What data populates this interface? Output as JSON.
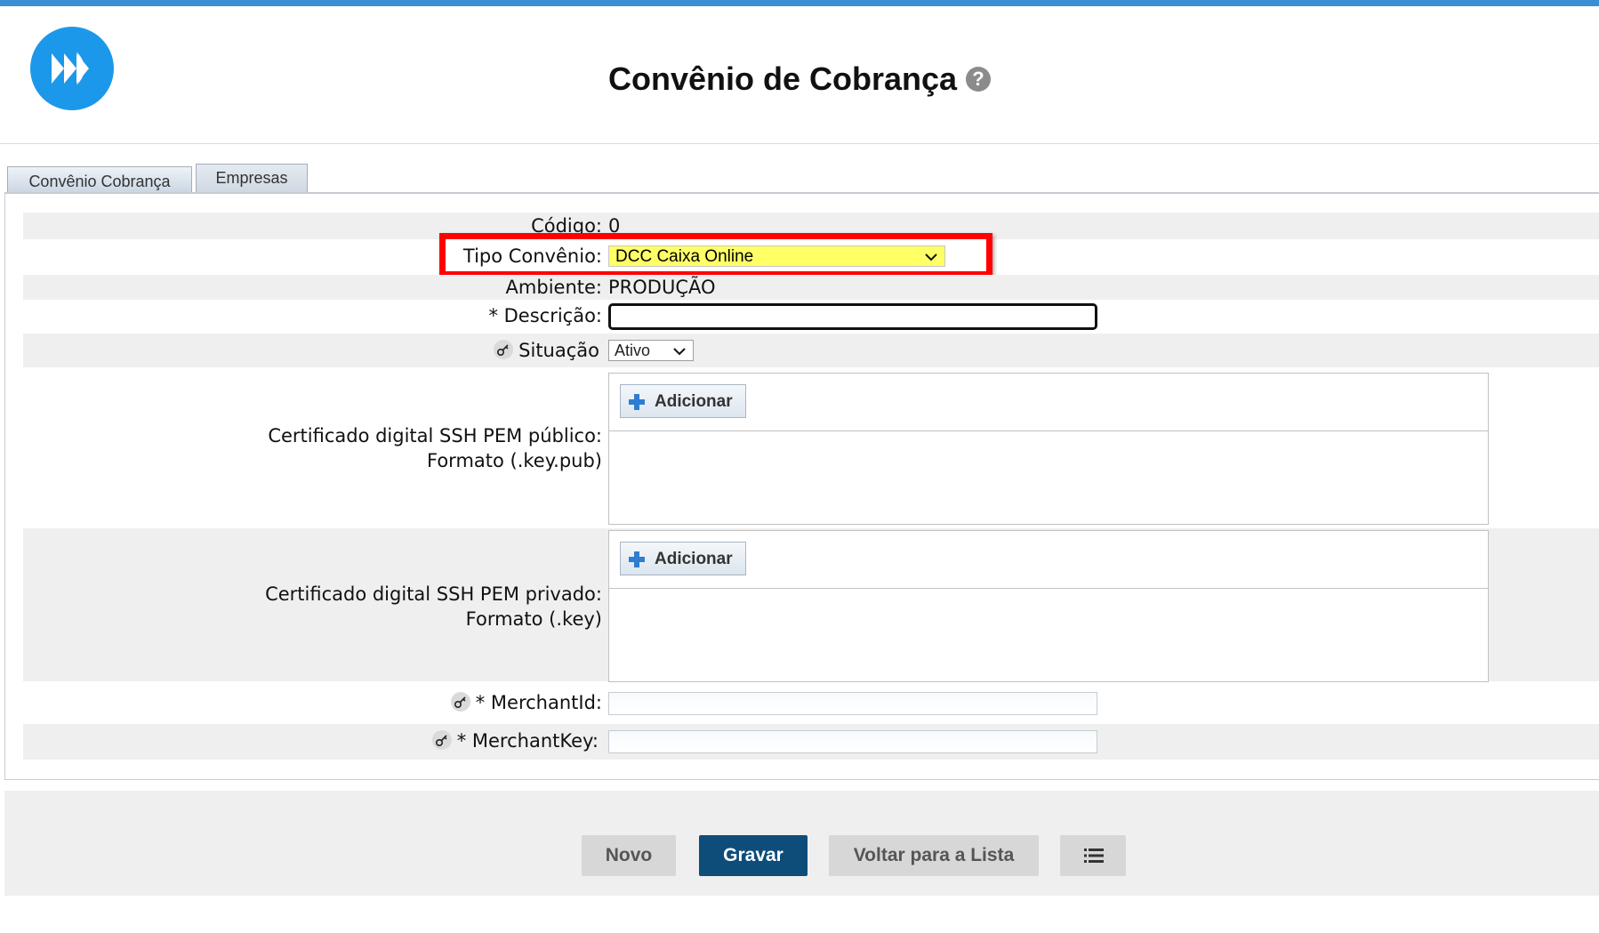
{
  "header": {
    "title": "Convênio de Cobrança",
    "help_icon": "?"
  },
  "tabs": [
    {
      "label": "Convênio Cobrança"
    },
    {
      "label": "Empresas"
    }
  ],
  "form": {
    "codigo": {
      "label": "Código:",
      "value": "0"
    },
    "tipo_convenio": {
      "label": "Tipo Convênio:",
      "selected": "DCC Caixa Online"
    },
    "ambiente": {
      "label": "Ambiente:",
      "value": "PRODUÇÃO"
    },
    "descricao": {
      "label": "* Descrição:",
      "value": ""
    },
    "situacao": {
      "label": "Situação",
      "selected": "Ativo"
    },
    "cert_publico": {
      "label_line1": "Certificado digital SSH PEM público:",
      "label_line2": "Formato (.key.pub)",
      "button": "Adicionar"
    },
    "cert_privado": {
      "label_line1": "Certificado digital SSH PEM privado:",
      "label_line2": "Formato (.key)",
      "button": "Adicionar"
    },
    "merchant_id": {
      "label": "* MerchantId:",
      "value": ""
    },
    "merchant_key": {
      "label": "* MerchantKey:",
      "value": ""
    }
  },
  "footer": {
    "novo": "Novo",
    "gravar": "Gravar",
    "voltar": "Voltar para a Lista"
  },
  "colors": {
    "accent": "#1c98ea",
    "highlight": "#ff0000",
    "primary_button": "#0e4c7a",
    "selected_field": "#ffff66"
  }
}
